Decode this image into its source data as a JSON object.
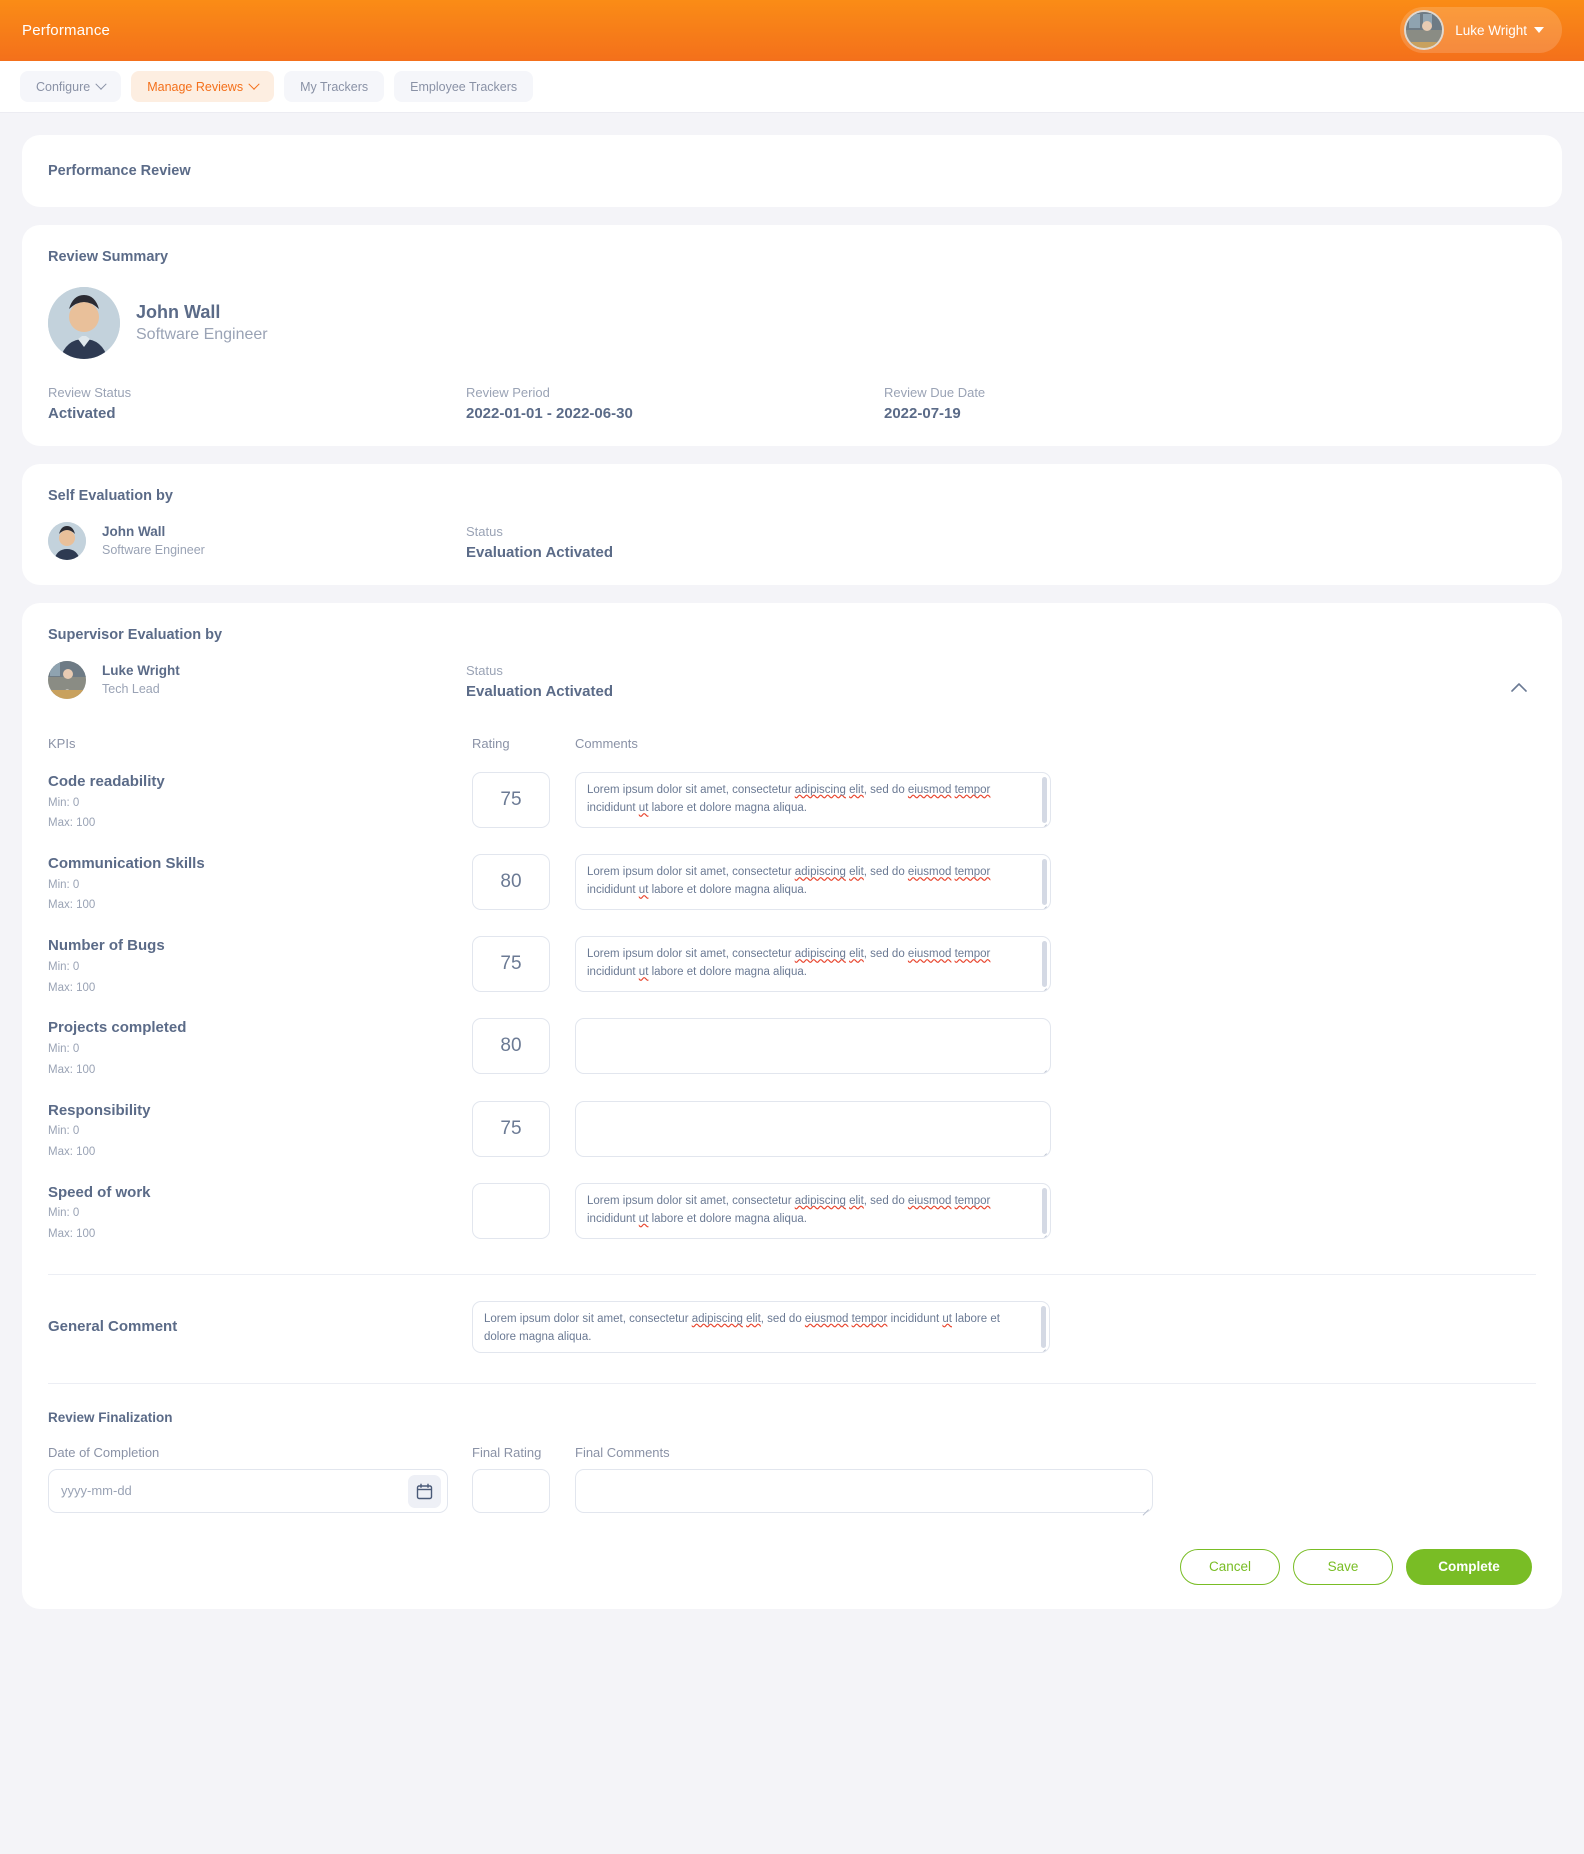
{
  "header": {
    "app_title": "Performance",
    "user_name": "Luke Wright",
    "avatar_icon": "user-photo",
    "caret_icon": "caret-down-icon",
    "brand_color": "#f4701b"
  },
  "nav": {
    "items": [
      {
        "label": "Configure",
        "has_caret": true,
        "active": false
      },
      {
        "label": "Manage Reviews",
        "has_caret": true,
        "active": true
      },
      {
        "label": "My Trackers",
        "has_caret": false,
        "active": false
      },
      {
        "label": "Employee Trackers",
        "has_caret": false,
        "active": false
      }
    ]
  },
  "page": {
    "title": "Performance Review"
  },
  "review_summary": {
    "title": "Review Summary",
    "employee": {
      "name": "John Wall",
      "role": "Software Engineer"
    },
    "stats": [
      {
        "label": "Review Status",
        "value": "Activated"
      },
      {
        "label": "Review Period",
        "value": "2022-01-01 - 2022-06-30"
      },
      {
        "label": "Review Due Date",
        "value": "2022-07-19"
      }
    ]
  },
  "self_evaluation": {
    "title": "Self Evaluation by",
    "person": {
      "name": "John Wall",
      "role": "Software Engineer"
    },
    "status_label": "Status",
    "status_value": "Evaluation Activated"
  },
  "supervisor_evaluation": {
    "title": "Supervisor Evaluation by",
    "person": {
      "name": "Luke Wright",
      "role": "Tech Lead"
    },
    "status_label": "Status",
    "status_value": "Evaluation Activated",
    "collapse_icon": "chevron-up-icon",
    "columns": {
      "kpi": "KPIs",
      "rating": "Rating",
      "comments": "Comments"
    },
    "comment_text_a": "Lorem ipsum dolor sit amet, consectetur ",
    "comment_text_b": "adipiscing",
    "comment_text_c": " ",
    "comment_text_d": "elit",
    "comment_text_e": ", sed do ",
    "comment_text_f": "eiusmod",
    "comment_text_g": " ",
    "comment_text_h": "tempor",
    "comment_text_i": " incididunt ",
    "comment_text_j": "ut",
    "comment_text_k": " labore et dolore magna aliqua.",
    "kpis": [
      {
        "name": "Code readability",
        "min": "Min: 0",
        "max": "Max: 100",
        "rating": "75",
        "has_comment": true
      },
      {
        "name": "Communication Skills",
        "min": "Min: 0",
        "max": "Max: 100",
        "rating": "80",
        "has_comment": true
      },
      {
        "name": "Number of Bugs",
        "min": "Min: 0",
        "max": "Max: 100",
        "rating": "75",
        "has_comment": true
      },
      {
        "name": "Projects completed",
        "min": "Min: 0",
        "max": "Max: 100",
        "rating": "80",
        "has_comment": false
      },
      {
        "name": "Responsibility",
        "min": "Min: 0",
        "max": "Max: 100",
        "rating": "75",
        "has_comment": false
      },
      {
        "name": "Speed of work",
        "min": "Min: 0",
        "max": "Max: 100",
        "rating": "",
        "has_comment": true
      }
    ],
    "general_comment": {
      "label": "General Comment",
      "value": "Lorem ipsum dolor sit amet, consectetur adipiscing elit, sed do eiusmod tempor incididunt ut labore et dolore magna aliqua."
    },
    "finalization": {
      "title": "Review Finalization",
      "date_label": "Date of Completion",
      "date_placeholder": "yyyy-mm-dd",
      "date_value": "",
      "calendar_icon": "calendar-icon",
      "final_rating_label": "Final Rating",
      "final_rating_value": "",
      "final_comments_label": "Final Comments",
      "final_comments_value": ""
    },
    "buttons": {
      "cancel": "Cancel",
      "save": "Save",
      "complete": "Complete"
    }
  }
}
